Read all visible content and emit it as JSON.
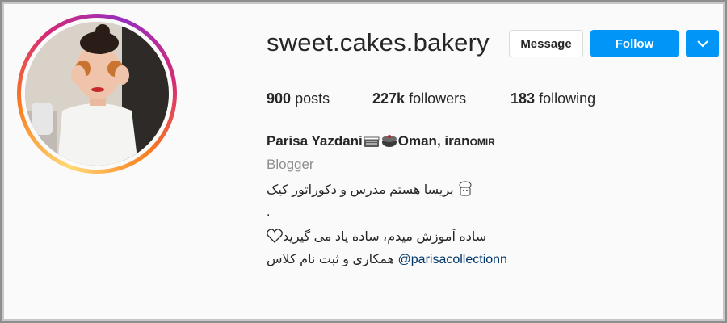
{
  "profile": {
    "username": "sweet.cakes.bakery",
    "full_name": "Parisa Yazdani",
    "location_text": "Oman, iran",
    "location_suffix": "OMIR",
    "category": "Blogger"
  },
  "actions": {
    "message_label": "Message",
    "follow_label": "Follow"
  },
  "stats": {
    "posts_count": "900",
    "posts_label": "posts",
    "followers_count": "227k",
    "followers_label": "followers",
    "following_count": "183",
    "following_label": "following"
  },
  "bio": {
    "line1": "پریسا هستم مدرس و دکوراتور کیک",
    "line2": ".",
    "line3": "ساده آموزش میدم، ساده یاد می گیرید",
    "line4_mention": "@parisacollectionn",
    "line4_text": "همکاری و ثبت نام کلاس"
  },
  "icons": {
    "cake_emoji": "cake-icon",
    "dropdown": "chevron-down-icon",
    "heart": "heart-outline-icon",
    "chef": "chef-icon"
  },
  "colors": {
    "follow_blue": "#0095f6",
    "text_dark": "#262626",
    "text_gray": "#8e8e8e",
    "mention_blue": "#00376b"
  }
}
